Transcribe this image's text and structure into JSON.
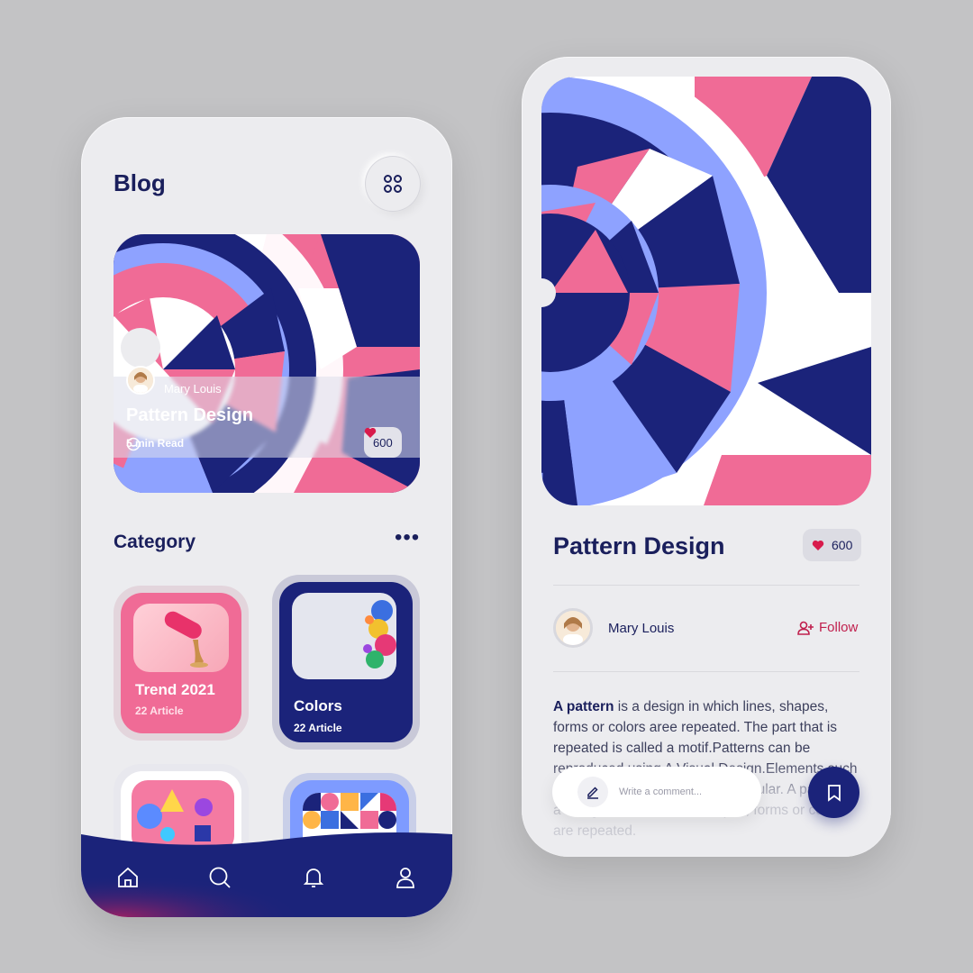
{
  "blog": {
    "title": "Blog",
    "hero": {
      "author": "Mary Louis",
      "title": "Pattern Design",
      "read_time": "5 min Read",
      "likes": "600"
    },
    "category": {
      "title": "Category",
      "items": [
        {
          "name": "Trend 2021",
          "count": "22 Article"
        },
        {
          "name": "Colors",
          "count": "22 Article"
        },
        {
          "name": "",
          "count": ""
        },
        {
          "name": "",
          "count": ""
        }
      ]
    },
    "nav": [
      "home-icon",
      "search-icon",
      "bell-icon",
      "user-icon"
    ]
  },
  "detail": {
    "title": "Pattern Design",
    "likes": "600",
    "author": "Mary Louis",
    "follow_label": "Follow",
    "paragraph_lead": "A pattern",
    "paragraph_rest": " is a design in which  lines, shapes, forms or colors aree repeated. The part that is repeated is called a motif.Patterns can be reproduced using A Visual Design.Elements such as shapes, colors regular or irregular. A pattern is a design in which lines, shapes, forms or colors are repeated.",
    "comment_placeholder": "Write a comment..."
  },
  "colors": {
    "navy": "#1b237a",
    "pink": "#f06b96",
    "accent_red": "#c0204e",
    "background": "#c3c3c5"
  }
}
